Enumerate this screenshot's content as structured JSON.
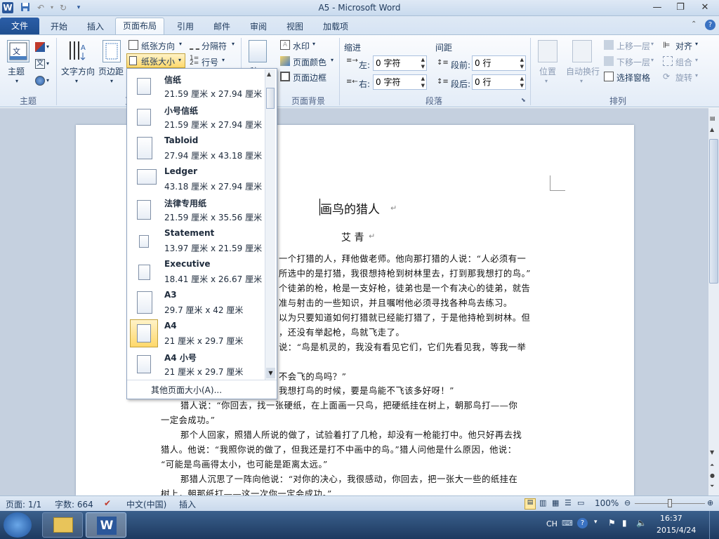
{
  "window": {
    "title": "A5 - Microsoft Word"
  },
  "tabs": [
    {
      "label": "文件"
    },
    {
      "label": "开始"
    },
    {
      "label": "插入"
    },
    {
      "label": "页面布局"
    },
    {
      "label": "引用"
    },
    {
      "label": "邮件"
    },
    {
      "label": "审阅"
    },
    {
      "label": "视图"
    },
    {
      "label": "加载项"
    }
  ],
  "ribbon": {
    "theme": {
      "themes_label": "主题",
      "group": "主题"
    },
    "page_setup": {
      "text_direction": "文字方向",
      "margins": "页边距",
      "orientation": "纸张方向",
      "size": "纸张大小",
      "breaks": "分隔符",
      "line_numbers": "行号",
      "group_fragment": "页"
    },
    "page_bg": {
      "watermark": "水印",
      "page_color": "页面颜色",
      "page_borders": "页面边框",
      "group": "页面背景",
      "stationery_fragment": "稿"
    },
    "paragraph": {
      "indent": "缩进",
      "spacing": "间距",
      "left_label": "左:",
      "left_value": "0 字符",
      "right_label": "右:",
      "right_value": "0 字符",
      "before_label": "段前:",
      "before_value": "0 行",
      "after_label": "段后:",
      "after_value": "0 行",
      "group": "段落"
    },
    "arrange": {
      "position": "位置",
      "wrap": "自动换行",
      "bring_forward": "上移一层",
      "send_backward": "下移一层",
      "selection_pane": "选择窗格",
      "align": "对齐",
      "group_obj": "组合",
      "rotate": "旋转",
      "group": "排列"
    }
  },
  "paper_sizes": [
    {
      "name": "信纸",
      "size": "21.59 厘米 x 27.94 厘米"
    },
    {
      "name": "小号信纸",
      "size": "21.59 厘米 x 27.94 厘米"
    },
    {
      "name": "Tabloid",
      "size": "27.94 厘米 x 43.18 厘米"
    },
    {
      "name": "Ledger",
      "size": "43.18 厘米 x 27.94 厘米"
    },
    {
      "name": "法律专用纸",
      "size": "21.59 厘米 x 35.56 厘米"
    },
    {
      "name": "Statement",
      "size": "13.97 厘米 x 21.59 厘米"
    },
    {
      "name": "Executive",
      "size": "18.41 厘米 x 26.67 厘米"
    },
    {
      "name": "A3",
      "size": "29.7 厘米 x 42 厘米"
    },
    {
      "name": "A4",
      "size": "21 厘米 x 29.7 厘米"
    },
    {
      "name": "A4 小号",
      "size": "21 厘米 x 29.7 厘米"
    }
  ],
  "paper_size_selected": "A4",
  "more_sizes": "其他页面大小(A)...",
  "document": {
    "title": "画鸟的猎人",
    "author": "艾  青",
    "lines": [
      "一个打猎的人，拜他做老师。他向那打猎的人说：“人必须有一",
      "所选中的是打猎，我很想持枪到树林里去，打到那我想打的鸟。”",
      "个徒弟的枪，枪是一支好枪，徒弟也是一个有决心的徒弟，就告",
      "准与射击的一些知识，并且嘱咐他必须寻找各种鸟去练习。",
      "以为只要知道如何打猎就已经能打猎了，于是他持枪到树林。但",
      "，还没有举起枪，鸟就飞走了。",
      "说：“鸟是机灵的，我没有看见它们，它们先看见我，等我一举",
      "不会飞的鸟吗？”",
      "我想打鸟的时候，要是鸟能不飞该多好呀！”",
      "猎人说：“你回去，找一张硬纸，在上面画一只鸟，把硬纸挂在树上，朝那鸟打——你",
      "一定会成功。”",
      "那个人回家，照猎人所说的做了，试验着打了几枪，却没有一枪能打中。他只好再去找",
      "猎人。他说：“我照你说的做了，但我还是打不中画中的鸟。”猎人问他是什么原因，他说：",
      "“可能是鸟画得太小，也可能是距离太远。”",
      "那猎人沉思了一阵向他说：“对你的决心，我很感动，你回去，把一张大一些的纸挂在",
      "树上，朝那纸打——这一次你一定会成功。”"
    ]
  },
  "status": {
    "page": "页面: 1/1",
    "words": "字数: 664",
    "language": "中文(中国)",
    "mode": "插入",
    "zoom": "100%"
  },
  "tray": {
    "ime": "CH",
    "time": "16:37",
    "date": "2015/4/24"
  }
}
